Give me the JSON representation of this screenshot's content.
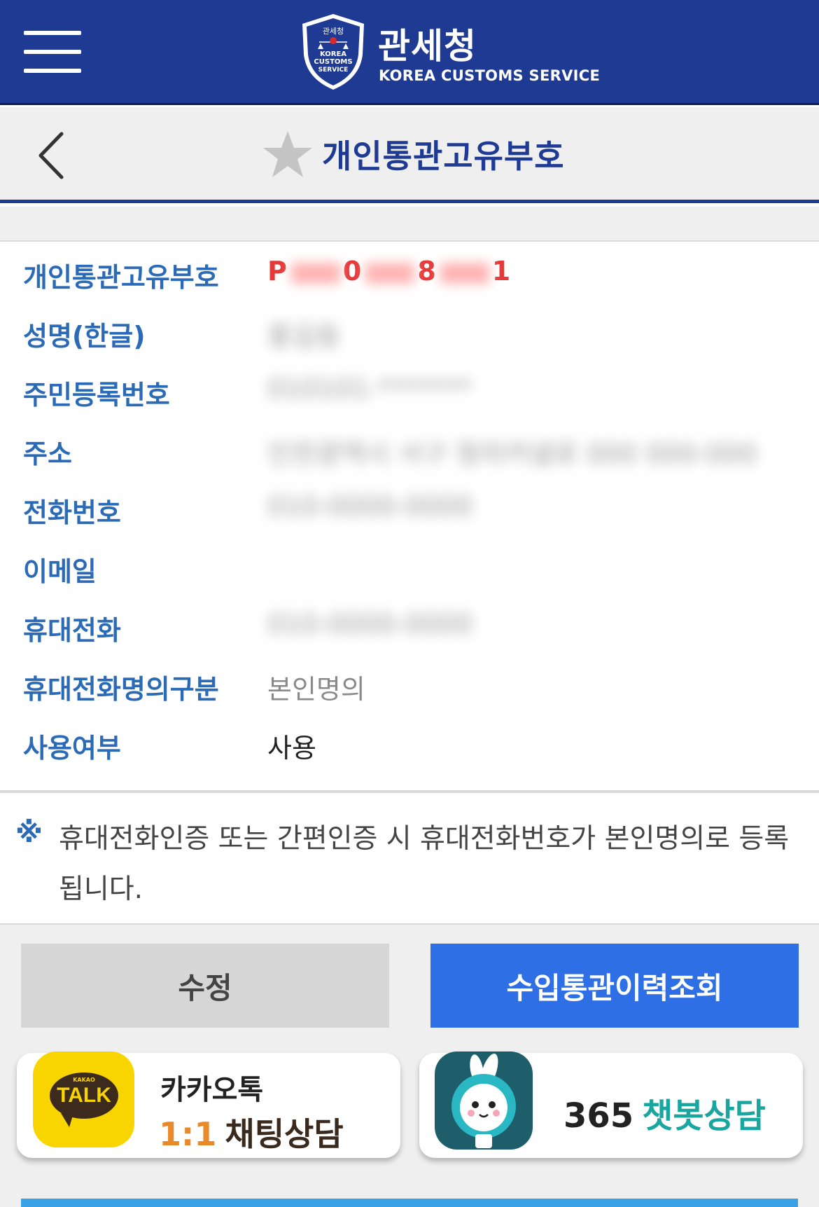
{
  "header": {
    "logo_kr": "관세청",
    "logo_en_1": "KOREA",
    "logo_en_2": "CUSTOMS",
    "logo_en_3": "SERVICE",
    "brand_kr": "관세청",
    "brand_en": "KOREA CUSTOMS SERVICE",
    "bg_color": "#1f3a93"
  },
  "titlebar": {
    "title": "개인통관고유부호",
    "favorite_icon": "star-icon",
    "back_icon": "chevron-left-icon"
  },
  "info": {
    "rows": [
      {
        "label": "개인통관고유부호",
        "value": "P0000080001",
        "style": "red-masked"
      },
      {
        "label": "성명(한글)",
        "value": "홍길동",
        "style": "blurred"
      },
      {
        "label": "주민등록번호",
        "value": "010101-*******",
        "style": "blurred"
      },
      {
        "label": "주소",
        "value": "인천광역시 서구 청라커낼로 000 000-000",
        "style": "blurred"
      },
      {
        "label": "전화번호",
        "value": "010-0000-0000",
        "style": "blurred"
      },
      {
        "label": "이메일",
        "value": "",
        "style": "empty"
      },
      {
        "label": "휴대전화",
        "value": "010-0000-0000",
        "style": "blurred"
      },
      {
        "label": "휴대전화명의구분",
        "value": "본인명의",
        "style": "gray"
      },
      {
        "label": "사용여부",
        "value": "사용",
        "style": "black"
      }
    ]
  },
  "note": {
    "mark": "※",
    "text": "휴대전화인증 또는 간편인증 시 휴대전화번호가 본인명의로 등록됩니다."
  },
  "buttons": {
    "edit": "수정",
    "history": "수입통관이력조회"
  },
  "cards": {
    "kakao": {
      "icon_small": "KAKAO",
      "icon_text": "TALK",
      "line1": "카카오톡",
      "line2_num": "1:1",
      "line2_text": "채팅상담"
    },
    "chatbot": {
      "num": "365",
      "text": "챗봇상담"
    }
  },
  "colors": {
    "label": "#2b6ab6",
    "accent_blue": "#2f6fe6",
    "red": "#e63a3a"
  }
}
